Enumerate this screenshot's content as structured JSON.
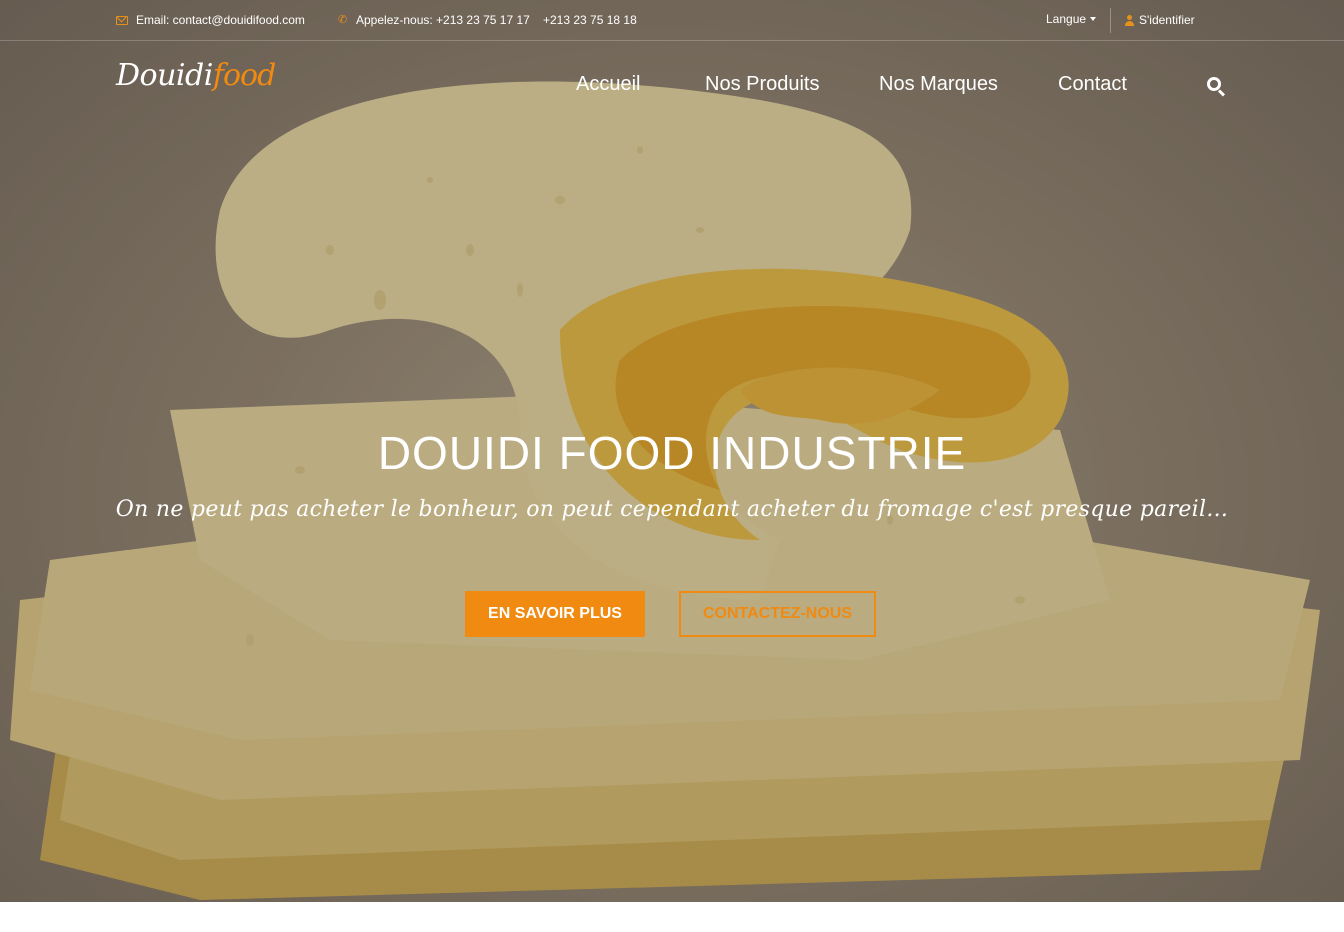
{
  "topbar": {
    "email_text": "Email: contact@douidifood.com",
    "phone_text": "Appelez-nous: +213 23 75 17 17",
    "phone2_text": "+213 23 75 18 18",
    "language_label": "Langue",
    "login_label": "S'identifier"
  },
  "brand": {
    "logo_part1": "Douidi",
    "logo_part2": "food",
    "accent_color": "#f08a10"
  },
  "nav": {
    "items": [
      {
        "label": "Accueil"
      },
      {
        "label": "Nos Produits"
      },
      {
        "label": "Nos Marques"
      },
      {
        "label": "Contact"
      }
    ],
    "search_icon": "search-icon"
  },
  "hero": {
    "title": "DOUIDI FOOD INDUSTRIE",
    "subtitle": "On ne peut pas acheter le bonheur, on peut cependant acheter du fromage c'est presque pareil...",
    "primary_button": "EN SAVOIR PLUS",
    "secondary_button": "CONTACTEZ-NOUS",
    "background_image": "cheese-slices"
  }
}
